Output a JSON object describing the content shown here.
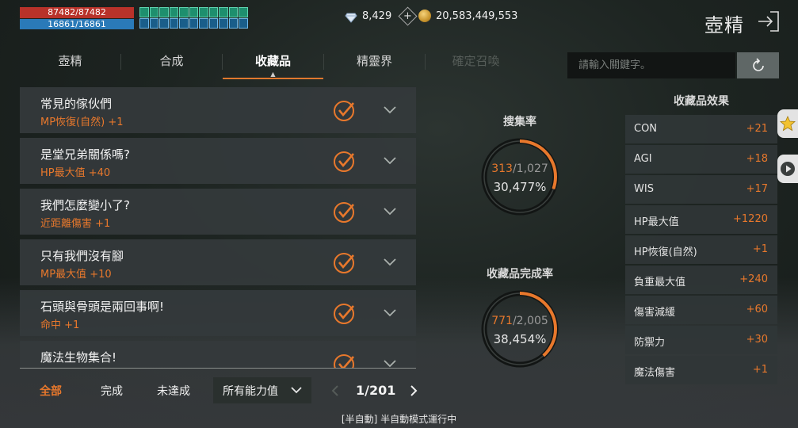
{
  "player": {
    "hp": "87482/87482",
    "mp": "16861/16861"
  },
  "currency": {
    "diamonds": "8,429",
    "gold": "20,583,449,553"
  },
  "page_title": "壺精",
  "tabs": [
    {
      "label": "壺精",
      "state": "normal"
    },
    {
      "label": "合成",
      "state": "normal"
    },
    {
      "label": "收藏品",
      "state": "active"
    },
    {
      "label": "精靈界",
      "state": "normal"
    },
    {
      "label": "確定召喚",
      "state": "disabled"
    }
  ],
  "search": {
    "placeholder": "請輸入關鍵字。"
  },
  "collections": [
    {
      "name": "常見的傢伙們",
      "effect": "MP恢復(自然)  +1"
    },
    {
      "name": "是堂兄弟關係嗎?",
      "effect": "HP最大值  +40"
    },
    {
      "name": "我們怎麼變小了?",
      "effect": "近距離傷害  +1"
    },
    {
      "name": "只有我們沒有腳",
      "effect": "MP最大值  +10"
    },
    {
      "name": "石頭與骨頭是兩回事啊!",
      "effect": "命中  +1"
    },
    {
      "name": "魔法生物集合!",
      "effect": ""
    }
  ],
  "filters": {
    "all": "全部",
    "complete": "完成",
    "incomplete": "未達成"
  },
  "dropdown": {
    "selected": "所有能力值"
  },
  "pager": {
    "text": "1/201"
  },
  "stats": {
    "collect_rate": {
      "label": "搜集率",
      "current": "313",
      "total": "/1,027",
      "percent": "30,477%",
      "fraction": 0.3048
    },
    "complete_rate": {
      "label": "收藏品完成率",
      "current": "771",
      "total": "/2,005",
      "percent": "38,454%",
      "fraction": 0.3845
    }
  },
  "effects": {
    "title": "收藏品效果",
    "items": [
      {
        "name": "CON",
        "value": "+21"
      },
      {
        "name": "AGI",
        "value": "+18"
      },
      {
        "name": "WIS",
        "value": "+17"
      },
      {
        "name": "HP最大值",
        "value": "+1220"
      },
      {
        "name": "HP恢復(自然)",
        "value": "+1"
      },
      {
        "name": "負重最大值",
        "value": "+240"
      },
      {
        "name": "傷害減緩",
        "value": "+60"
      },
      {
        "name": "防禦力",
        "value": "+30"
      },
      {
        "name": "魔法傷害",
        "value": "+1"
      }
    ]
  },
  "status_text": "[半自動] 半自動模式運行中",
  "colors": {
    "accent": "#e8782c",
    "hp": "#b8322a",
    "mp": "#2a7ab8"
  }
}
